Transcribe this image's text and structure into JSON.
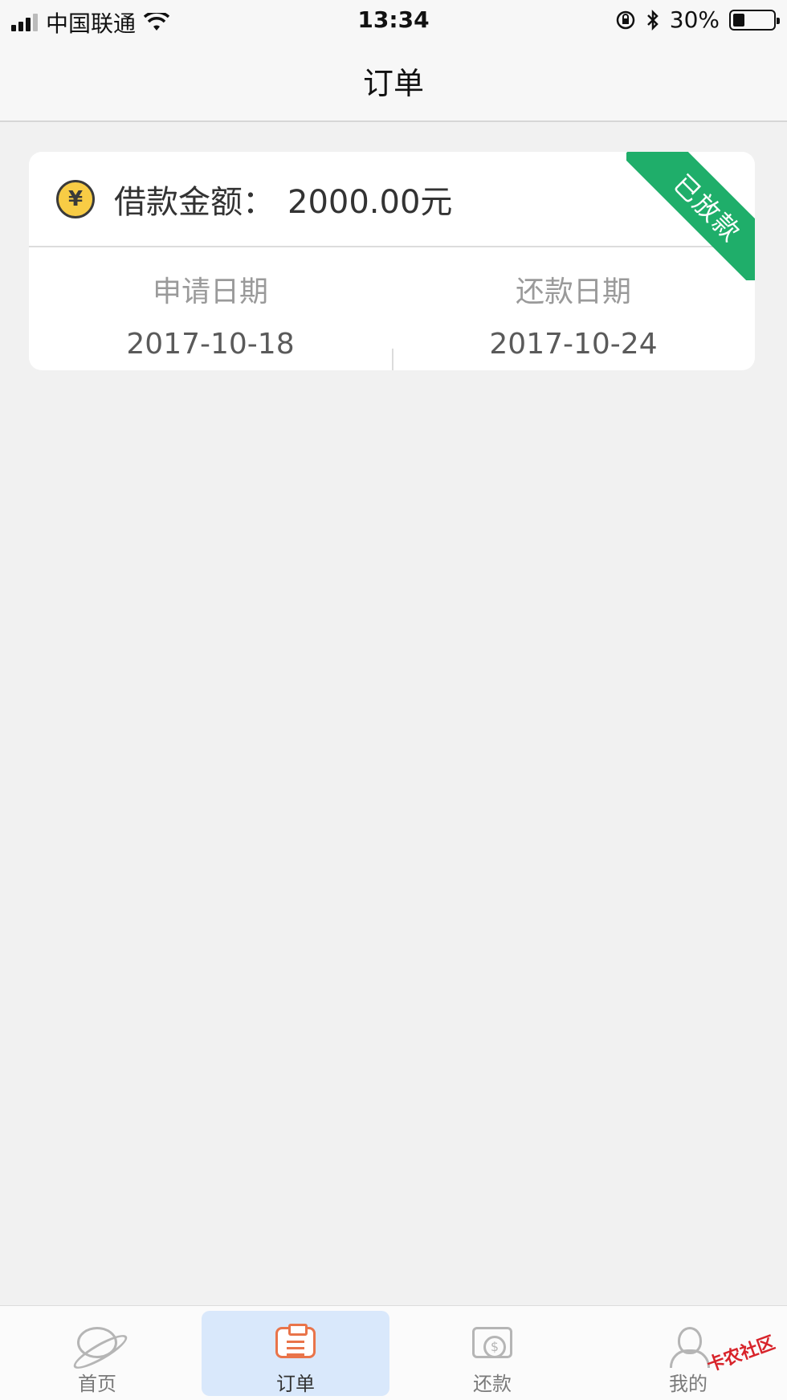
{
  "status_bar": {
    "carrier": "中国联通",
    "time": "13:34",
    "battery_percent": "30%",
    "battery_level": 0.3
  },
  "nav": {
    "title": "订单"
  },
  "order_card": {
    "amount_label": "借款金额：",
    "amount_value": "2000.00元",
    "status_ribbon": "已放款",
    "apply_date_label": "申请日期",
    "apply_date": "2017-10-18",
    "repay_date_label": "还款日期",
    "repay_date": "2017-10-24"
  },
  "tabbar": {
    "items": [
      {
        "label": "首页",
        "icon": "planet-icon"
      },
      {
        "label": "订单",
        "icon": "clipboard-icon",
        "active": true
      },
      {
        "label": "还款",
        "icon": "repay-icon"
      },
      {
        "label": "我的",
        "icon": "user-icon"
      }
    ]
  },
  "watermark": "卡农社区",
  "colors": {
    "ribbon": "#1fae6a",
    "active_tab": "#d9e8fb",
    "coin": "#f8cc45",
    "active_icon": "#e9744a"
  }
}
